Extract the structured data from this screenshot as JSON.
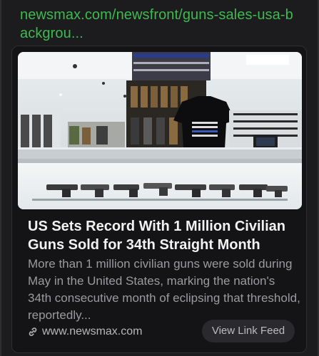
{
  "link_preview": {
    "url": "newsmax.com/newsfront/guns-sales-usa-backgrou...",
    "image_alt": "gun store display case",
    "headline": "US Sets Record With 1 Million Civilian Guns Sold for 34th Straight Month",
    "description": "More than 1 million civilian guns were sold during May in the United States, marking the nation's 34th consecutive month of eclipsing that threshold, reportedly...",
    "domain": "www.newsmax.com",
    "domain_icon": "link-icon",
    "feed_button_label": "View Link Feed"
  },
  "colors": {
    "background": "#1c1c1e",
    "url_green": "#3fb950",
    "card_bg": "#141416",
    "headline": "#f2f2f2",
    "muted": "#9b9b9f",
    "button_bg": "#2a2a2e"
  }
}
